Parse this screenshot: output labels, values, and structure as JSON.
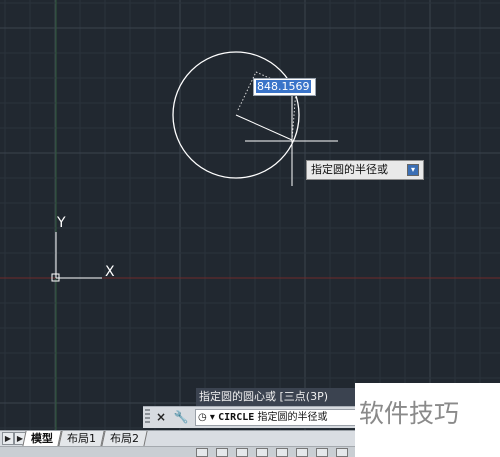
{
  "radius_input": {
    "value": "848.1569"
  },
  "tooltip": {
    "text": "指定圆的半径或",
    "button_icon": "down-arrow-icon"
  },
  "command_history": {
    "text": "指定圆的圆心或 [三点(3P)"
  },
  "command_line": {
    "close_icon": "×",
    "wrench_icon": "🔧",
    "prompt_icon": "◷",
    "command": "CIRCLE",
    "prompt_text": "指定圆的半径或"
  },
  "layout_tabs": {
    "items": [
      {
        "label": "模型",
        "active": true
      },
      {
        "label": "布局1",
        "active": false
      },
      {
        "label": "布局2",
        "active": false
      }
    ]
  },
  "ucs_icon": {
    "x_label": "X",
    "y_label": "Y"
  },
  "watermark": {
    "text": "软件技巧"
  },
  "colors": {
    "canvas_bg": "#212830",
    "grid_minor": "#2b333c",
    "grid_major": "#3a434d",
    "x_axis": "#6e2a2a",
    "y_axis": "#2f5a3a",
    "entity": "#ffffff",
    "dimension": "#d8d8d8"
  }
}
